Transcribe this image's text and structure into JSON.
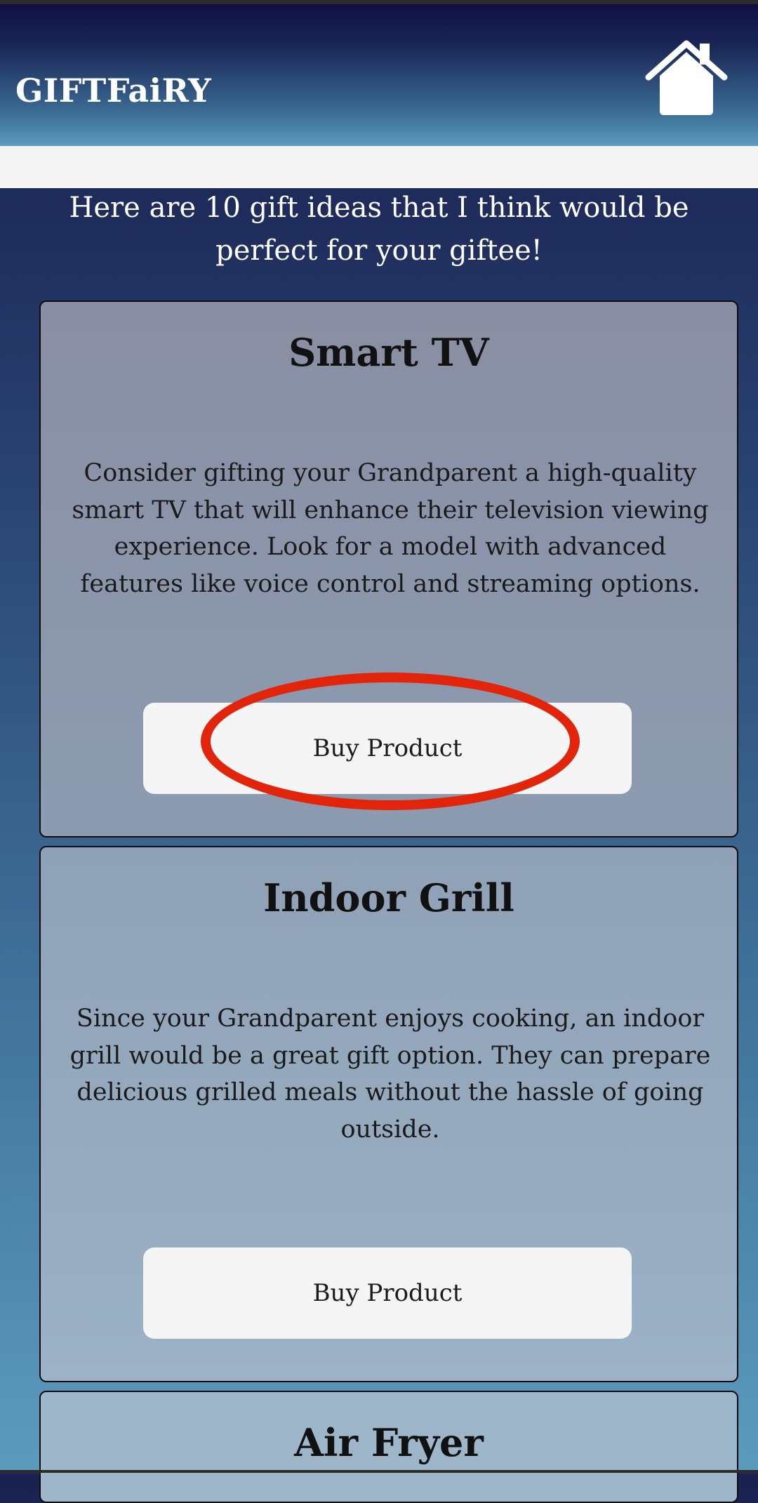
{
  "app": {
    "brand": "GIFTFaiRY",
    "home_icon": "home-icon"
  },
  "intro": "Here are 10 gift ideas that I think would be perfect for your giftee!",
  "gifts": [
    {
      "title": "Smart TV",
      "description": "Consider gifting your Grandparent a high-quality smart TV that will enhance their television viewing experience. Look for a model with advanced features like voice control and streaming options.",
      "button_label": "Buy Product"
    },
    {
      "title": "Indoor Grill",
      "description": "Since your Grandparent enjoys cooking, an indoor grill would be a great gift option. They can prepare delicious grilled meals without the hassle of going outside.",
      "button_label": "Buy Product"
    },
    {
      "title": "Air Fryer"
    }
  ],
  "colors": {
    "annotation": "#e2240a",
    "button_bg": "#f5f5f5",
    "header_top": "#0f1040",
    "header_bottom": "#5c9bbd"
  }
}
